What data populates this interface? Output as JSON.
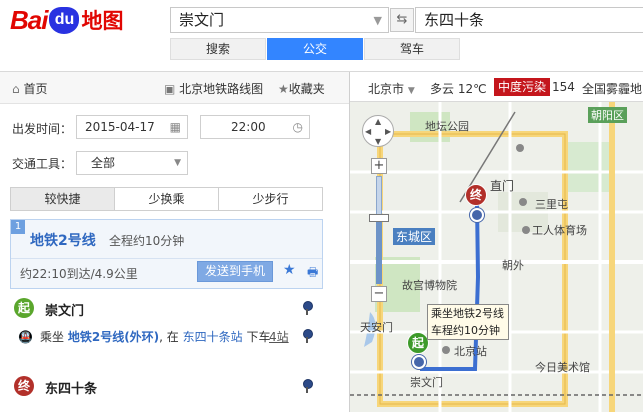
{
  "header": {
    "logo_bai": "Bai",
    "logo_du": "du",
    "logo_map": "地图",
    "from_value": "崇文门",
    "to_value": "东四十条",
    "modes": [
      {
        "label": "搜索",
        "active": false
      },
      {
        "label": "公交",
        "active": true
      },
      {
        "label": "驾车",
        "active": false
      }
    ]
  },
  "side": {
    "home": "首页",
    "subway_map": "北京地铁路线图",
    "favorites": "收藏夹",
    "depart_label": "出发时间：",
    "date_value": "2015-04-17",
    "time_value": "22:00",
    "transport_label": "交通工具：",
    "transport_value": "全部",
    "tabs": [
      {
        "label": "较快捷",
        "active": true
      },
      {
        "label": "少换乘",
        "active": false
      },
      {
        "label": "少步行",
        "active": false
      }
    ],
    "plan": {
      "index": "1",
      "line": "地铁2号线",
      "duration": "全程约10分钟",
      "arrival": "约22:10到达/4.9公里",
      "send_button": "发送到手机"
    },
    "start_mark": "起",
    "start_name": "崇文门",
    "ride_prefix": "乘坐",
    "ride_line": "地铁2号线(外环)",
    "ride_mid": ", 在",
    "ride_station": "东四十条站",
    "ride_suffix": "下车",
    "stations_count": "4站",
    "end_mark": "终",
    "end_name": "东四十条"
  },
  "map": {
    "city": "北京市",
    "weather": "多云 12℃",
    "aqi_label": "中度污染",
    "aqi_value": "154",
    "warning": "全国雾霾地图",
    "labels": {
      "chaoyangqu": "朝阳区",
      "dongchengqu": "东城区",
      "dizhigongyuan": "地坛公园",
      "zhimen": "直门",
      "sanlitun": "三里屯",
      "gongrentiyuchang": "工人体育场",
      "chaowai": "朝外",
      "gugong": "故宫博物院",
      "tiananmen": "天安门",
      "beijingzhan": "北京站",
      "chongwenmen": "崇文门",
      "jintianmeishuguan": "今日美术馆"
    },
    "tooltip_line1": "乘坐地铁2号线",
    "tooltip_line2": "车程约10分钟",
    "end_mark": "终",
    "start_mark": "起"
  },
  "colors": {
    "accent": "#3385ff",
    "logo_red": "#e10602",
    "logo_blue": "#2932e1",
    "route_blue": "#3c6fd1",
    "aqi_red": "#c4161c"
  }
}
